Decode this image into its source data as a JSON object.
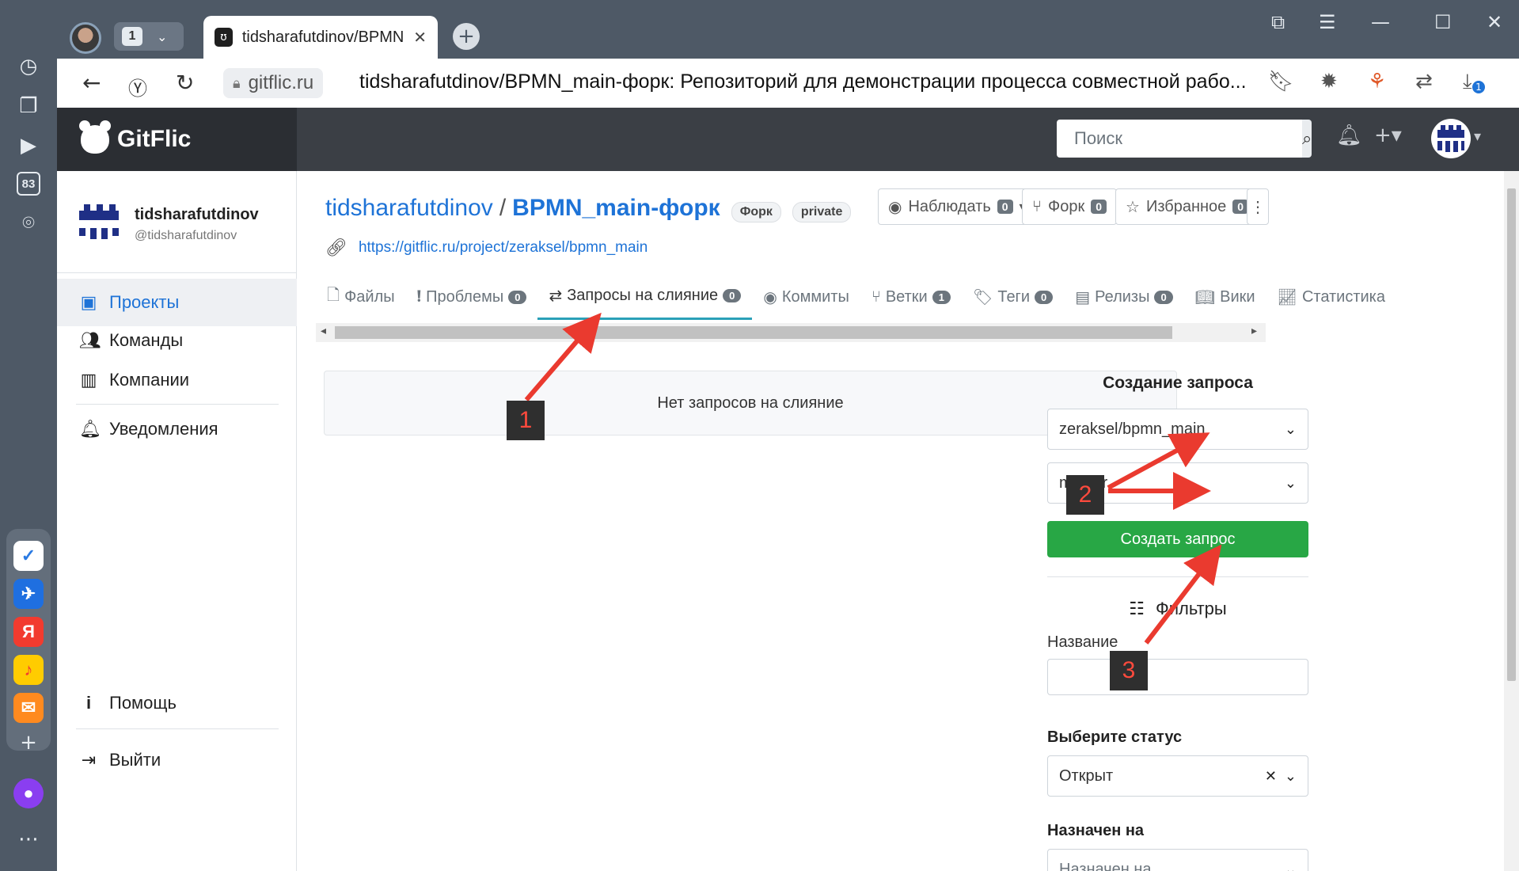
{
  "browser": {
    "tab_count": "1",
    "tab_title": "tidsharafutdinov/BPMN_main-форк",
    "address_domain": "gitflic.ru",
    "page_title": "tidsharafutdinov/BPMN_main-форк: Репозиторий для демонстрации процесса совместной рабо...",
    "rail_badge": "83",
    "rail_yandex": "Я",
    "download_badge": "1"
  },
  "header": {
    "brand": "GitFlic",
    "search_placeholder": "Поиск"
  },
  "sidebar": {
    "username": "tidsharafutdinov",
    "handle": "@tidsharafutdinov",
    "items": [
      {
        "label": "Проекты",
        "icon": "project-icon",
        "active": true
      },
      {
        "label": "Команды",
        "icon": "team-icon"
      },
      {
        "label": "Компании",
        "icon": "company-icon"
      },
      {
        "label": "Уведомления",
        "icon": "bell-icon"
      }
    ],
    "help": "Помощь",
    "logout": "Выйти"
  },
  "repo": {
    "owner": "tidsharafutdinov",
    "slash": "/",
    "name": "BPMN_main-форк",
    "pill_fork": "Форк",
    "pill_private": "private",
    "url": "https://gitflic.ru/project/zeraksel/bpmn_main",
    "actions": {
      "watch_label": "Наблюдать",
      "watch_count": "0",
      "fork_label": "Форк",
      "fork_count": "0",
      "fav_label": "Избранное",
      "fav_count": "0"
    }
  },
  "tabs": [
    {
      "label": "Файлы",
      "icon": "file-icon"
    },
    {
      "label": "Проблемы",
      "count": "0",
      "icon": "issue-icon"
    },
    {
      "label": "Запросы на слияние",
      "count": "0",
      "icon": "merge-icon",
      "active": true
    },
    {
      "label": "Коммиты",
      "icon": "commit-icon"
    },
    {
      "label": "Ветки",
      "count": "1",
      "icon": "branch-icon"
    },
    {
      "label": "Теги",
      "count": "0",
      "icon": "tag-icon"
    },
    {
      "label": "Релизы",
      "count": "0",
      "icon": "release-icon"
    },
    {
      "label": "Вики",
      "icon": "book-icon"
    },
    {
      "label": "Статистика",
      "icon": "chart-icon"
    }
  ],
  "main": {
    "empty_text": "Нет запросов на слияние"
  },
  "create_request": {
    "title": "Создание запроса",
    "repo_select": "zeraksel/bpmn_main",
    "branch_select": "master",
    "button": "Создать запрос"
  },
  "filters": {
    "title": "Фильтры",
    "name_label": "Название",
    "name_value": "",
    "status_label": "Выберите статус",
    "status_value": "Открыт",
    "assignee_label": "Назначен на",
    "assignee_placeholder": "Назначен на"
  },
  "annotations": [
    "1",
    "2",
    "3"
  ],
  "colors": {
    "accent": "#1e73d7",
    "success": "#28a745",
    "arrow": "#ea3a2f"
  }
}
